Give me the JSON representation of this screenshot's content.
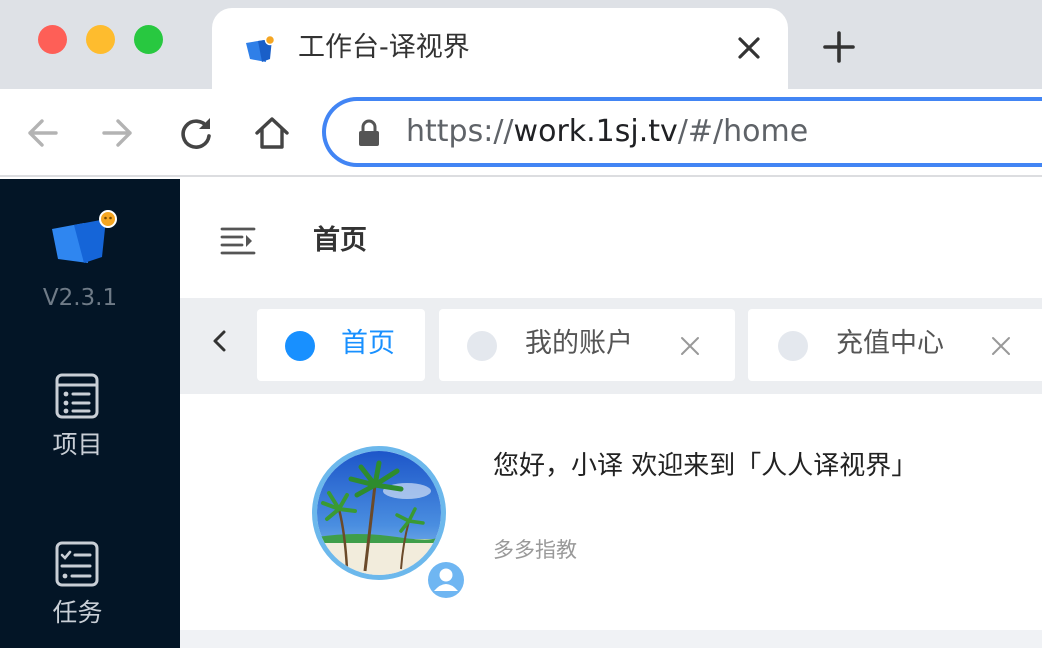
{
  "browser": {
    "tab_title": "工作台-译视界",
    "url_scheme": "https://",
    "url_host": "work.1sj.tv",
    "url_path": "/#/home",
    "icons": [
      "back-arrow-icon",
      "forward-arrow-icon",
      "reload-icon",
      "home-icon",
      "lock-icon",
      "close-icon",
      "plus-icon"
    ]
  },
  "sidebar": {
    "version": "V2.3.1",
    "items": [
      {
        "label": "项目",
        "icon": "list-icon"
      },
      {
        "label": "任务",
        "icon": "checklist-icon"
      }
    ]
  },
  "header": {
    "title": "首页",
    "icon": "menu-fold-icon"
  },
  "tags": [
    {
      "label": "首页",
      "active": true
    },
    {
      "label": "我的账户",
      "active": false
    },
    {
      "label": "充值中心",
      "active": false
    }
  ],
  "welcome": {
    "greeting": "您好，小译 欢迎来到「人人译视界」",
    "subtitle": "多多指教"
  },
  "colors": {
    "sidebar_bg": "#031526",
    "accent": "#1890ff",
    "omnibox_focus": "#4285f4",
    "tabbar_bg": "#dee1e6"
  }
}
